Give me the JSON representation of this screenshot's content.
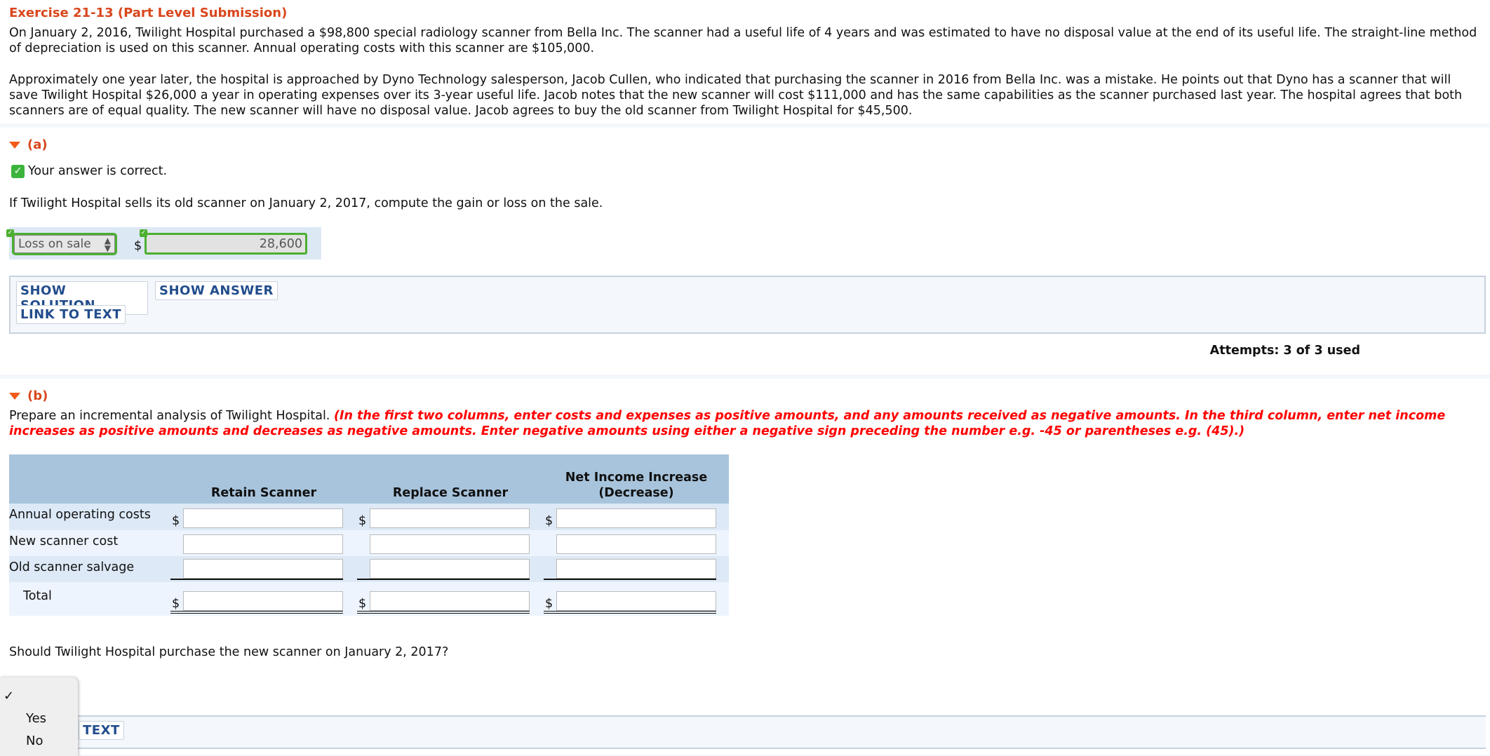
{
  "title": "Exercise 21-13 (Part Level Submission)",
  "paragraph1": "On January 2, 2016, Twilight Hospital purchased a $98,800 special radiology scanner from Bella Inc. The scanner had a useful life of 4 years and was estimated to have no disposal value at the end of its useful life. The straight-line method of depreciation is used on this scanner. Annual operating costs with this scanner are $105,000.",
  "paragraph2": "Approximately one year later, the hospital is approached by Dyno Technology salesperson, Jacob Cullen, who indicated that purchasing the scanner in 2016 from Bella Inc. was a mistake. He points out that Dyno has a scanner that will save Twilight Hospital $26,000 a year in operating expenses over its 3-year useful life. Jacob notes that the new scanner will cost $111,000 and has the same capabilities as the scanner purchased last year. The hospital agrees that both scanners are of equal quality. The new scanner will have no disposal value. Jacob agrees to buy the old scanner from Twilight Hospital for $45,500.",
  "part_a": {
    "label": "(a)",
    "status": "Your answer is correct.",
    "question": "If Twilight Hospital sells its old scanner on January 2, 2017, compute the gain or loss on the sale.",
    "select_value": "Loss on sale",
    "currency": "$",
    "amount": "28,600",
    "show_solution": "SHOW SOLUTION",
    "show_answer": "SHOW ANSWER",
    "link_to_text": "LINK TO TEXT",
    "attempts": "Attempts: 3 of 3 used"
  },
  "part_b": {
    "label": "(b)",
    "intro": "Prepare an incremental analysis of Twilight Hospital.",
    "instruction": "(In the first two columns, enter costs and expenses as positive amounts, and any amounts received as negative amounts.  In the third column, enter net income increases as positive amounts and decreases as negative amounts. Enter negative amounts using either a negative sign preceding the number e.g. -45 or parentheses e.g. (45).)",
    "columns": [
      "Retain Scanner",
      "Replace Scanner",
      "Net Income Increase (Decrease)"
    ],
    "rows": [
      {
        "label": "Annual operating costs",
        "dollar": "$"
      },
      {
        "label": "New scanner cost",
        "dollar": ""
      },
      {
        "label": "Old scanner salvage",
        "dollar": ""
      },
      {
        "label": "Total",
        "dollar": "$"
      }
    ],
    "question": "Should Twilight Hospital purchase the new scanner on January 2, 2017?",
    "dropdown": {
      "options": [
        "Yes",
        "No"
      ],
      "checkmark": "✓"
    },
    "link_partial": "TEXT"
  },
  "colors": {
    "title": "#d9461c",
    "instruction": "#ff0000",
    "button_text": "#224d8c",
    "correct": "#4caf30",
    "table_header": "#a8c4dc"
  }
}
